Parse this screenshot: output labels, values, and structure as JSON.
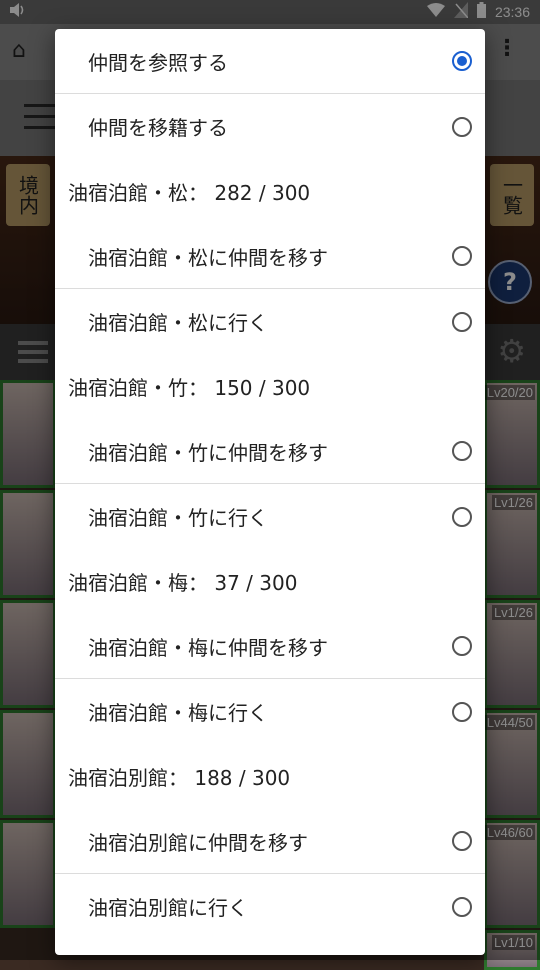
{
  "status_bar": {
    "time": "23:36",
    "icons": [
      "volume-icon",
      "wifi-icon",
      "no-sim-icon",
      "battery-icon"
    ]
  },
  "background": {
    "seal_left": "境内",
    "seal_right": "一覧",
    "help_label": "?",
    "card_levels_right": [
      "Lv20/20",
      "Lv1/26",
      "Lv1/26",
      "Lv44/50",
      "Lv46/60",
      "Lv1/10"
    ]
  },
  "dialog": {
    "rows": [
      {
        "kind": "option",
        "label": "仲間を参照する",
        "checked": true,
        "divider": true
      },
      {
        "kind": "option",
        "label": "仲間を移籍する",
        "checked": false,
        "divider": false
      },
      {
        "kind": "header",
        "label": "油宿泊館・松： 282 / 300"
      },
      {
        "kind": "option",
        "label": "油宿泊館・松に仲間を移す",
        "checked": false,
        "divider": true
      },
      {
        "kind": "option",
        "label": "油宿泊館・松に行く",
        "checked": false,
        "divider": false
      },
      {
        "kind": "header",
        "label": "油宿泊館・竹： 150 / 300"
      },
      {
        "kind": "option",
        "label": "油宿泊館・竹に仲間を移す",
        "checked": false,
        "divider": true
      },
      {
        "kind": "option",
        "label": "油宿泊館・竹に行く",
        "checked": false,
        "divider": false
      },
      {
        "kind": "header",
        "label": "油宿泊館・梅： 37 / 300"
      },
      {
        "kind": "option",
        "label": "油宿泊館・梅に仲間を移す",
        "checked": false,
        "divider": true
      },
      {
        "kind": "option",
        "label": "油宿泊館・梅に行く",
        "checked": false,
        "divider": false
      },
      {
        "kind": "header",
        "label": "油宿泊別館： 188 / 300"
      },
      {
        "kind": "option",
        "label": "油宿泊別館に仲間を移す",
        "checked": false,
        "divider": true
      },
      {
        "kind": "option",
        "label": "油宿泊別館に行く",
        "checked": false,
        "divider": false
      }
    ]
  },
  "colors": {
    "accent": "#1a5fd0",
    "scrim": "rgba(0,0,0,0.45)"
  }
}
